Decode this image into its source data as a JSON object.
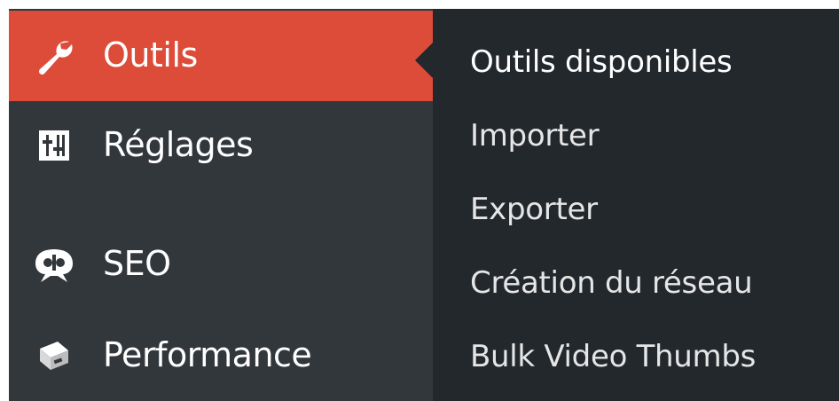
{
  "menu": {
    "items": [
      {
        "label": "Outils",
        "icon": "wrench-icon",
        "active": true
      },
      {
        "label": "Réglages",
        "icon": "sliders-icon",
        "active": false
      },
      {
        "label": "SEO",
        "icon": "seo-logo-icon",
        "active": false
      },
      {
        "label": "Performance",
        "icon": "performance-box-icon",
        "active": false
      }
    ]
  },
  "submenu": {
    "items": [
      {
        "label": "Outils disponibles"
      },
      {
        "label": "Importer"
      },
      {
        "label": "Exporter"
      },
      {
        "label": "Création du réseau"
      },
      {
        "label": "Bulk Video Thumbs"
      }
    ]
  },
  "colors": {
    "active_bg": "#dd4b39",
    "menu_bg": "#32373c",
    "submenu_bg": "#23282d",
    "text": "#ffffff"
  }
}
